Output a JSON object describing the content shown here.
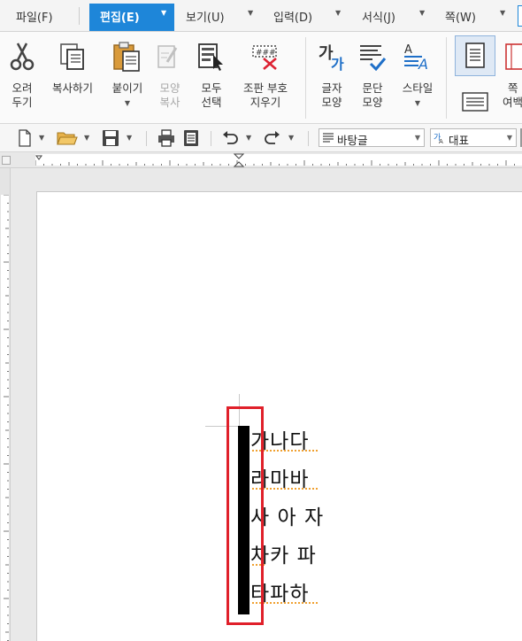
{
  "menubar": {
    "items": [
      {
        "label": "파일(F)"
      },
      {
        "label": "편집(E)"
      },
      {
        "label": "보기(U)"
      },
      {
        "label": "입력(D)"
      },
      {
        "label": "서식(J)"
      },
      {
        "label": "쪽(W)"
      }
    ],
    "active_color": "#1e86d9"
  },
  "ribbon": {
    "cut": {
      "line1": "오려",
      "line2": "두기"
    },
    "copy": {
      "label": "복사하기"
    },
    "paste": {
      "label": "붙이기"
    },
    "format_copy": {
      "line1": "모양",
      "line2": "복사"
    },
    "select_all": {
      "line1": "모두",
      "line2": "선택"
    },
    "clear_marks": {
      "line1": "조판 부호",
      "line2": "지우기"
    },
    "char_shape": {
      "line1": "글자",
      "line2": "모양"
    },
    "para_shape": {
      "line1": "문단",
      "line2": "모양"
    },
    "style": {
      "label": "스타일"
    },
    "page_margin": {
      "line1": "쪽",
      "line2": "여백"
    }
  },
  "toolbar": {
    "style_combo": "바탕글",
    "font_combo": "대표"
  },
  "document": {
    "lines": [
      "가나다",
      "라마바",
      "사 아 자",
      "차카 파",
      "타파하"
    ]
  },
  "colors": {
    "highlight_box": "#e0202a",
    "spell_underline": "#f0a030"
  }
}
